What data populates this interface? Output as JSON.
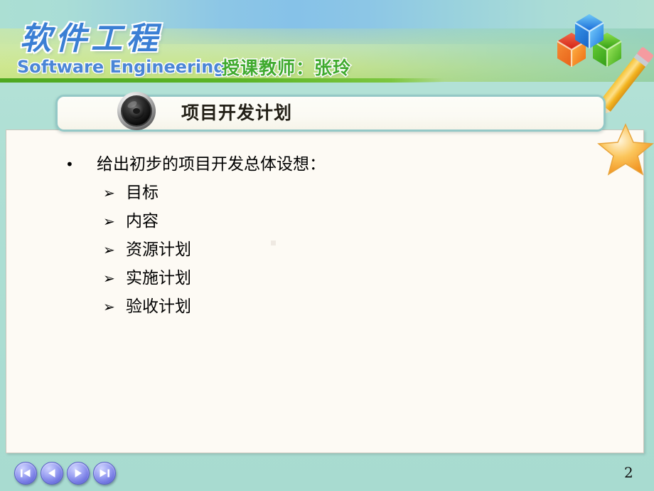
{
  "slide": {
    "page_number": "2",
    "background_color": "#aedfd4",
    "content_box_color": "#fdfaf4"
  },
  "header": {
    "brand_cn": "软件工程",
    "brand_en": "Software Engineering",
    "teacher_label": "授课教师：张玲",
    "brand_cn_color": "#3b7fd4",
    "brand_en_color": "#4b86d6",
    "teacher_color": "#3faa2e",
    "green_bar_color": "#5cb527"
  },
  "title": {
    "text": "项目开发计划",
    "icon": "speaker-lens-icon"
  },
  "body": {
    "main_bullet_marker": "•",
    "main_bullet": "给出初步的项目开发总体设想：",
    "sub_marker": "➢",
    "sub_items": [
      {
        "label": "目标"
      },
      {
        "label": "内容"
      },
      {
        "label": "资源计划"
      },
      {
        "label": "实施计划"
      },
      {
        "label": "验收计划"
      }
    ]
  },
  "decorations": {
    "cubes": [
      "blue-cube",
      "red-cube",
      "green-cube"
    ],
    "pencil": "pencil-icon",
    "star": "star-icon"
  },
  "footer": {
    "nav_buttons": [
      {
        "name": "first-slide-button",
        "icon": "skip-to-start-icon"
      },
      {
        "name": "previous-slide-button",
        "icon": "previous-icon"
      },
      {
        "name": "next-slide-button",
        "icon": "next-icon"
      },
      {
        "name": "last-slide-button",
        "icon": "skip-to-end-icon"
      }
    ],
    "nav_button_color": "#6f74e0"
  }
}
